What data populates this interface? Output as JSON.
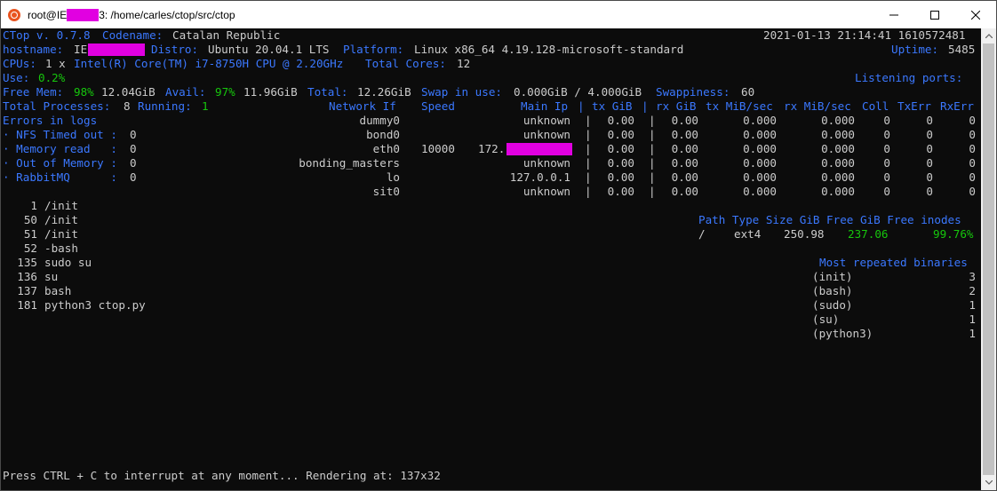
{
  "window": {
    "title_prefix": "root@IE",
    "title_suffix": "3: /home/carles/ctop/src/ctop",
    "minimize_label": "–",
    "maximize_label": "☐",
    "close_label": "✕"
  },
  "header": {
    "app": "CTop v. 0.7.8",
    "codename_label": "Codename:",
    "codename": "Catalan Republic",
    "datetime": "2021-01-13 21:14:41 1610572481",
    "hostname_label": "hostname:",
    "hostname_prefix": "IE",
    "distro_label": "Distro:",
    "distro": "Ubuntu 20.04.1 LTS",
    "platform_label": "Platform:",
    "platform": "Linux x86_64 4.19.128-microsoft-standard",
    "uptime_label": "Uptime:",
    "uptime": "5485",
    "cpus_label": "CPUs:",
    "cpus": "1 x",
    "cpu_model": "Intel(R) Core(TM) i7-8750H CPU @ 2.20GHz",
    "total_cores_label": "Total Cores:",
    "total_cores": "12",
    "use_label": "Use:",
    "use": "0.2%",
    "listening_label": "Listening ports:",
    "free_mem_label": "Free Mem:",
    "free_mem_pct": "98%",
    "free_mem": "12.04GiB",
    "avail_label": "Avail:",
    "avail_pct": "97%",
    "avail": "11.96GiB",
    "total_label": "Total:",
    "total": "12.26GiB",
    "swap_label": "Swap in use:",
    "swap": "0.000GiB / 4.000GiB",
    "swappiness_label": "Swappiness:",
    "swappiness": "60",
    "total_proc_label": "Total Processes:",
    "total_proc": "8",
    "running_label": "Running:",
    "running": "1"
  },
  "errors": {
    "title": "Errors in logs",
    "items": [
      {
        "label": "· NFS Timed out :",
        "value": "0"
      },
      {
        "label": "· Memory read   :",
        "value": "0"
      },
      {
        "label": "· Out of Memory :",
        "value": "0"
      },
      {
        "label": "· RabbitMQ      :",
        "value": "0"
      }
    ]
  },
  "network": {
    "headers": [
      "Network If",
      "Speed",
      "Main Ip",
      "|",
      "tx GiB",
      "|",
      "rx GiB",
      "tx MiB/sec",
      "rx MiB/sec",
      "Coll",
      "TxErr",
      "RxErr"
    ],
    "rows": [
      {
        "iface": "dummy0",
        "speed": "",
        "ip": "unknown",
        "tx": "0.00",
        "rx": "0.00",
        "txs": "0.000",
        "rxs": "0.000",
        "coll": "0",
        "txerr": "0",
        "rxerr": "0"
      },
      {
        "iface": "bond0",
        "speed": "",
        "ip": "unknown",
        "tx": "0.00",
        "rx": "0.00",
        "txs": "0.000",
        "rxs": "0.000",
        "coll": "0",
        "txerr": "0",
        "rxerr": "0"
      },
      {
        "iface": "eth0",
        "speed": "10000",
        "ip": "172.",
        "tx": "0.00",
        "rx": "0.00",
        "txs": "0.000",
        "rxs": "0.000",
        "coll": "0",
        "txerr": "0",
        "rxerr": "0"
      },
      {
        "iface": "bonding_masters",
        "speed": "",
        "ip": "unknown",
        "tx": "0.00",
        "rx": "0.00",
        "txs": "0.000",
        "rxs": "0.000",
        "coll": "0",
        "txerr": "0",
        "rxerr": "0"
      },
      {
        "iface": "lo",
        "speed": "",
        "ip": "127.0.0.1",
        "tx": "0.00",
        "rx": "0.00",
        "txs": "0.000",
        "rxs": "0.000",
        "coll": "0",
        "txerr": "0",
        "rxerr": "0"
      },
      {
        "iface": "sit0",
        "speed": "",
        "ip": "unknown",
        "tx": "0.00",
        "rx": "0.00",
        "txs": "0.000",
        "rxs": "0.000",
        "coll": "0",
        "txerr": "0",
        "rxerr": "0"
      }
    ],
    "separator": "|"
  },
  "processes": [
    {
      "pid": "1",
      "cmd": "/init"
    },
    {
      "pid": "50",
      "cmd": "/init"
    },
    {
      "pid": "51",
      "cmd": "/init"
    },
    {
      "pid": "52",
      "cmd": "-bash"
    },
    {
      "pid": "135",
      "cmd": "sudo su"
    },
    {
      "pid": "136",
      "cmd": "su"
    },
    {
      "pid": "137",
      "cmd": "bash"
    },
    {
      "pid": "181",
      "cmd": "python3 ctop.py"
    }
  ],
  "disk": {
    "header": "Path Type Size GiB Free GiB Free inodes",
    "path": "/",
    "type": "ext4",
    "size": "250.98",
    "free": "237.06",
    "inodes": "99.76%"
  },
  "binaries": {
    "title": "Most repeated binaries",
    "items": [
      {
        "name": "(init)",
        "count": "3"
      },
      {
        "name": "(bash)",
        "count": "2"
      },
      {
        "name": "(sudo)",
        "count": "1"
      },
      {
        "name": "(su)",
        "count": "1"
      },
      {
        "name": "(python3)",
        "count": "1"
      }
    ]
  },
  "footer": {
    "text": "Press CTRL + C to interrupt at any moment... Rendering at: 137x32"
  },
  "colors": {
    "accent_blue": "#3b78ff",
    "accent_green": "#16c60c",
    "redaction": "#e100e1",
    "background": "#0c0c0c",
    "foreground": "#cccccc"
  }
}
